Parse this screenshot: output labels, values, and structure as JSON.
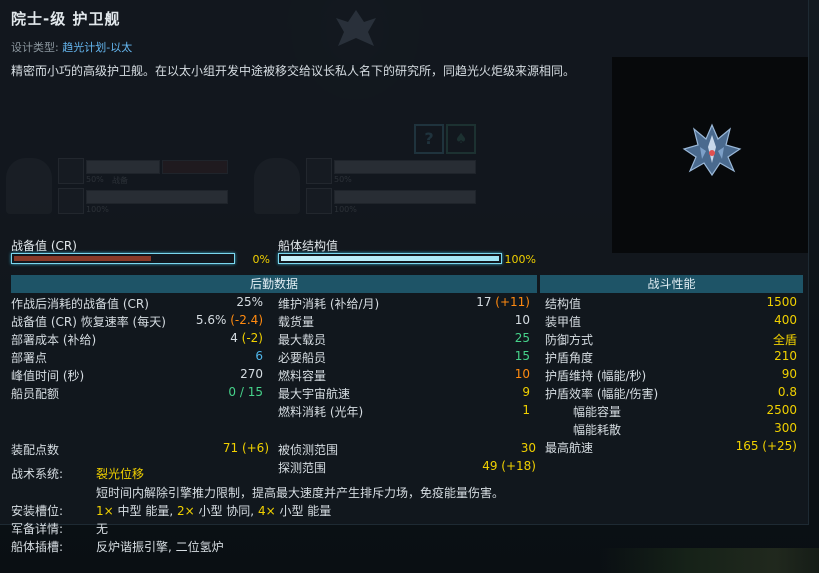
{
  "ship": {
    "title": "院士-级 护卫舰",
    "design_label": "设计类型:",
    "design_value": "趋光计划-以太",
    "description": "精密而小巧的高级护卫舰。在以太小组开发中途被移交给议长私人名下的研究所，同趋光火炬级来源相同。"
  },
  "bars": {
    "cr_label": "战备值 (CR)",
    "cr_value": "0%",
    "cr_level": 0.63,
    "hull_label": "船体结构值",
    "hull_value": "100%",
    "hull_level": 1.0
  },
  "background_crew": {
    "pct1": "50%",
    "tag1": "战备",
    "pct2": "100%",
    "pct3": "50%",
    "pct4": "100%"
  },
  "headers": {
    "logistics": "后勤数据",
    "combat": "战斗性能"
  },
  "col1": [
    {
      "label": "作战后消耗的战备值 (CR)",
      "value": "25%",
      "extra": ""
    },
    {
      "label": "战备值 (CR) 恢复速率 (每天)",
      "value": "5.6%",
      "extra": " (-2.4)"
    },
    {
      "label": "部署成本 (补给)",
      "value": "4",
      "extra": " (-2)"
    },
    {
      "label": "部署点",
      "value": "6",
      "extra": ""
    },
    {
      "label": "峰值时间 (秒)",
      "value": "270",
      "extra": ""
    },
    {
      "label": "船员配额",
      "value": "0 / 15",
      "extra": ""
    }
  ],
  "col2": [
    {
      "label": "维护消耗 (补给/月)",
      "value": "17",
      "extra": " (+11)"
    },
    {
      "label": "载货量",
      "value": "10",
      "extra": ""
    },
    {
      "label": "最大载员",
      "value": "25",
      "extra": ""
    },
    {
      "label": "必要船员",
      "value": "15",
      "extra": ""
    },
    {
      "label": "燃料容量",
      "value": "10",
      "extra": ""
    },
    {
      "label": "最大宇宙航速",
      "value": "9",
      "extra": ""
    },
    {
      "label": "燃料消耗 (光年)",
      "value": "1",
      "extra": ""
    }
  ],
  "col3": [
    {
      "label": "结构值",
      "value": "1500"
    },
    {
      "label": "装甲值",
      "value": "400"
    },
    {
      "label": "防御方式",
      "value": "全盾"
    },
    {
      "label": "护盾角度",
      "value": "210"
    },
    {
      "label": "护盾维持 (幅能/秒)",
      "value": "90"
    },
    {
      "label": "护盾效率 (幅能/伤害)",
      "value": "0.8"
    },
    {
      "label": "幅能容量",
      "value": "2500"
    },
    {
      "label": "幅能耗散",
      "value": "300"
    },
    {
      "label": "最高航速",
      "value": "165",
      "extra": " (+25)"
    }
  ],
  "bottom": {
    "op_label": "装配点数",
    "op_value": "71 (+6)",
    "detect_label": "被侦测范围",
    "detect_value": "30",
    "sensor_label": "探测范围",
    "sensor_value": "49 (+18)",
    "system_label": "战术系统:",
    "system_name": "裂光位移",
    "system_desc": "短时间内解除引擎推力限制，提高最大速度并产生排斥力场，免疫能量伤害。",
    "mounts_label": "安装槽位:",
    "mounts": [
      {
        "count": "1×",
        "text": " 中型 能量, "
      },
      {
        "count": "2×",
        "text": " 小型 协同, "
      },
      {
        "count": "4×",
        "text": " 小型 能量"
      }
    ],
    "armaments_label": "军备详情:",
    "armaments_value": "无",
    "hullmods_label": "船体插槽:",
    "hullmods_value": "反炉谐振引擎, 二位氢炉"
  },
  "colors": {
    "accent_yellow": "#f0d000",
    "accent_orange": "#ff8a10",
    "accent_green": "#46d28a",
    "accent_blue": "#4fb6ea",
    "header_bg": "#1e5467"
  }
}
